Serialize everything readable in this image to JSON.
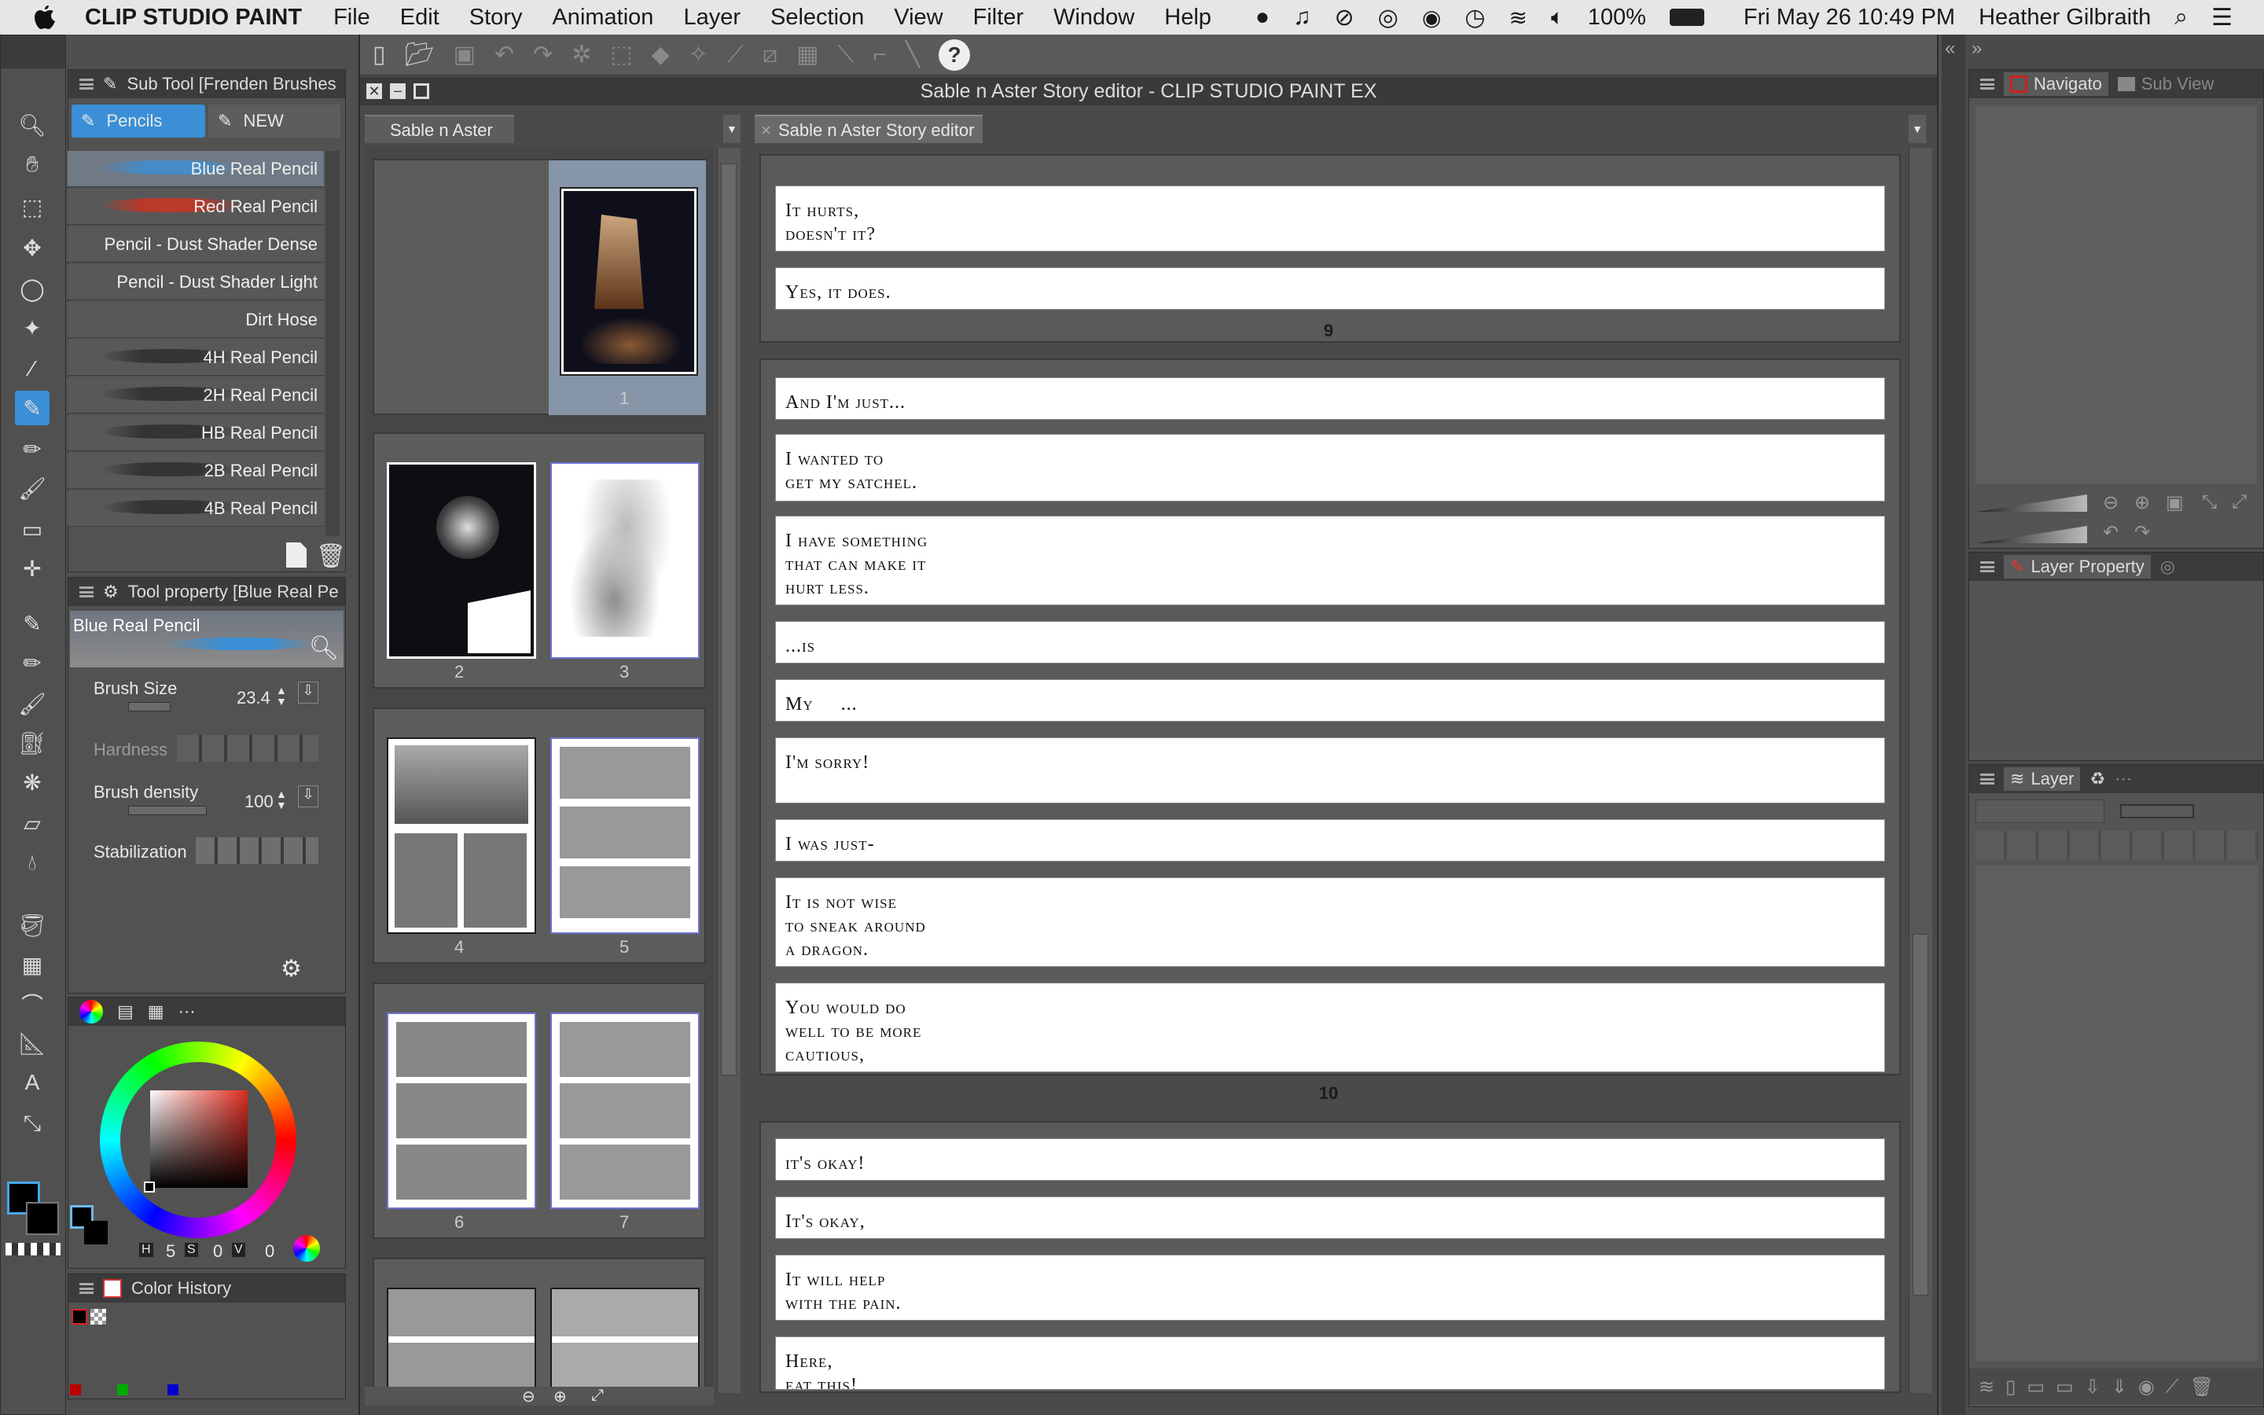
{
  "menubar": {
    "app_name": "CLIP STUDIO PAINT",
    "menus": [
      "File",
      "Edit",
      "Story",
      "Animation",
      "Layer",
      "Selection",
      "View",
      "Filter",
      "Window",
      "Help"
    ],
    "battery": "100%",
    "datetime": "Fri May 26  10:49 PM",
    "user": "Heather Gilbraith"
  },
  "window": {
    "title": "Sable n Aster Story editor - CLIP STUDIO PAINT EX"
  },
  "subtool": {
    "header": "Sub Tool [Frenden Brushes",
    "tabs": [
      "Pencils",
      "NEW"
    ],
    "brushes": [
      "Blue Real Pencil",
      "Red Real Pencil",
      "Pencil - Dust Shader Dense",
      "Pencil - Dust Shader Light",
      "Dirt Hose",
      "4H Real Pencil",
      "2H Real Pencil",
      "HB Real Pencil",
      "2B Real Pencil",
      "4B Real Pencil"
    ],
    "brush_colors": [
      "#3a8fd6",
      "#d2311f",
      "#5a5a5a",
      "#5a5a5a",
      "#5a5a5a",
      "#3a3a3a",
      "#333333",
      "#2f2f2f",
      "#2a2a2a",
      "#242424"
    ]
  },
  "toolprop": {
    "header": "Tool property [Blue Real Pe",
    "brush_name": "Blue Real Pencil",
    "brush_size_label": "Brush Size",
    "brush_size_value": "23.4",
    "hardness_label": "Hardness",
    "density_label": "Brush density",
    "density_value": "100",
    "stabilization_label": "Stabilization"
  },
  "color": {
    "hsv": {
      "h_label": "H",
      "h": "5",
      "s_label": "S",
      "s": "0",
      "v_label": "V",
      "v": "0"
    }
  },
  "color_history": {
    "header": "Color History"
  },
  "pages_panel": {
    "tab": "Sable n Aster",
    "pages": [
      "1",
      "2",
      "3",
      "4",
      "5",
      "6",
      "7"
    ]
  },
  "story_editor": {
    "tab": "Sable n Aster Story editor",
    "blocks": [
      {
        "page": "9",
        "lines": [
          "It hurts,\ndoesn't it?",
          "Yes, it does."
        ]
      },
      {
        "page": "10",
        "lines": [
          "And I'm just...",
          "I wanted to\nget my satchel.",
          "I have something\nthat can make it\nhurt less.",
          "...is",
          "My     ...",
          "I'm sorry!",
          "I was just-",
          "It is not wise\nto sneak around\na dragon.",
          "You would do\nwell to be more\ncautious,"
        ]
      },
      {
        "page": "",
        "lines": [
          "it's okay!",
          "It's okay,",
          "It will help\nwith the pain.",
          "Here,\neat this!"
        ]
      }
    ]
  },
  "right_panels": {
    "navigator": "Navigato",
    "subview": "Sub View",
    "layer_property": "Layer Property",
    "layer": "Layer"
  }
}
